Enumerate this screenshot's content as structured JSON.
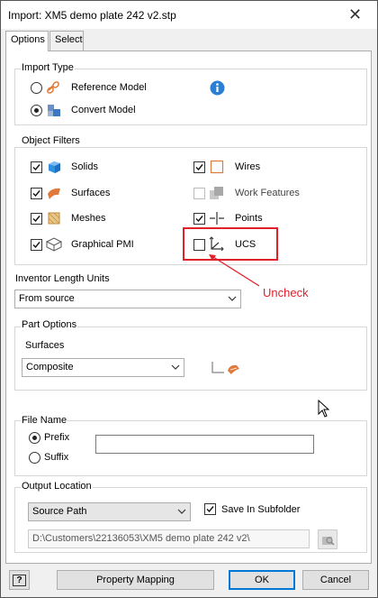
{
  "window": {
    "title": "Import: XM5 demo plate 242 v2.stp",
    "close_glyph": "✕"
  },
  "tabs": [
    {
      "label": "Options",
      "active": true
    },
    {
      "label": "Select",
      "active": false
    }
  ],
  "import_type": {
    "group_label": "Import Type",
    "options": [
      {
        "label": "Reference Model",
        "selected": false,
        "icon": "reference-model-icon"
      },
      {
        "label": "Convert Model",
        "selected": true,
        "icon": "convert-model-icon"
      }
    ],
    "info_icon": "info-icon"
  },
  "object_filters": {
    "group_label": "Object Filters",
    "items": [
      {
        "label": "Solids",
        "checked": true,
        "icon": "solids-icon"
      },
      {
        "label": "Surfaces",
        "checked": true,
        "icon": "surfaces-icon"
      },
      {
        "label": "Meshes",
        "checked": true,
        "icon": "meshes-icon"
      },
      {
        "label": "Graphical PMI",
        "checked": true,
        "icon": "graphical-pmi-icon"
      },
      {
        "label": "Wires",
        "checked": true,
        "icon": "wires-icon"
      },
      {
        "label": "Work Features",
        "checked": false,
        "disabled": true,
        "icon": "work-features-icon"
      },
      {
        "label": "Points",
        "checked": true,
        "icon": "points-icon"
      },
      {
        "label": "UCS",
        "checked": false,
        "icon": "ucs-icon"
      }
    ]
  },
  "annotation": {
    "text": "Uncheck",
    "color": "#e0202a"
  },
  "length_units": {
    "label": "Inventor Length Units",
    "value": "From source"
  },
  "part_options": {
    "group_label": "Part Options",
    "surfaces_label": "Surfaces",
    "surfaces_value": "Composite"
  },
  "file_name": {
    "group_label": "File Name",
    "options": [
      {
        "label": "Prefix",
        "selected": true
      },
      {
        "label": "Suffix",
        "selected": false
      }
    ],
    "value": ""
  },
  "output_location": {
    "group_label": "Output Location",
    "location_value": "Source Path",
    "save_in_subfolder_label": "Save In Subfolder",
    "save_in_subfolder_checked": true,
    "path": "D:\\Customers\\22136053\\XM5 demo plate 242 v2\\"
  },
  "footer": {
    "help_glyph": "?",
    "property_mapping_label": "Property Mapping",
    "ok_label": "OK",
    "cancel_label": "Cancel"
  },
  "colors": {
    "accent": "#0078d7",
    "highlight": "#e0202a"
  }
}
